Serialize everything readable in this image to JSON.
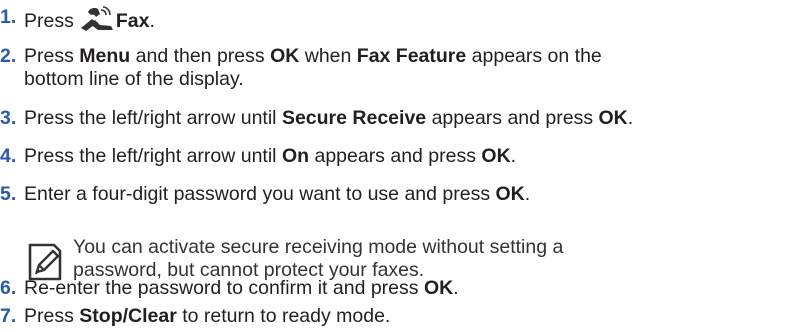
{
  "steps": [
    {
      "num": "1.",
      "a": "Press",
      "b": "Fax",
      "c": "."
    },
    {
      "num": "2.",
      "a": "Press",
      "b": "Menu",
      "c": "and then press",
      "d": "OK",
      "e": "when",
      "f": "Fax Feature",
      "g": "appears on the",
      "line2": "bottom line of the display."
    },
    {
      "num": "3.",
      "a": "Press the left/right arrow until",
      "b": "Secure Receive",
      "c": "appears and press",
      "d": "OK",
      "e": "."
    },
    {
      "num": "4.",
      "a": "Press the left/right arrow until",
      "b": "On",
      "c": "appears and press",
      "d": "OK",
      "e": "."
    },
    {
      "num": "5.",
      "a": "Enter a four-digit password you want to use and press",
      "b": "OK",
      "c": "."
    },
    {
      "num": "6.",
      "a": "Re-enter the password to confirm it and press",
      "b": "OK",
      "c": "."
    },
    {
      "num": "7.",
      "a": "Press",
      "b": "Stop/Clear",
      "c": "to return to ready mode."
    }
  ],
  "note": {
    "icon": "note-pencil-icon",
    "line1": "You can activate secure receiving mode without setting a",
    "line2": "password, but cannot protect your faxes."
  },
  "icons": {
    "fax": "fax-icon"
  },
  "colors": {
    "step_number": "#2a5ba8",
    "text": "#231f20"
  }
}
